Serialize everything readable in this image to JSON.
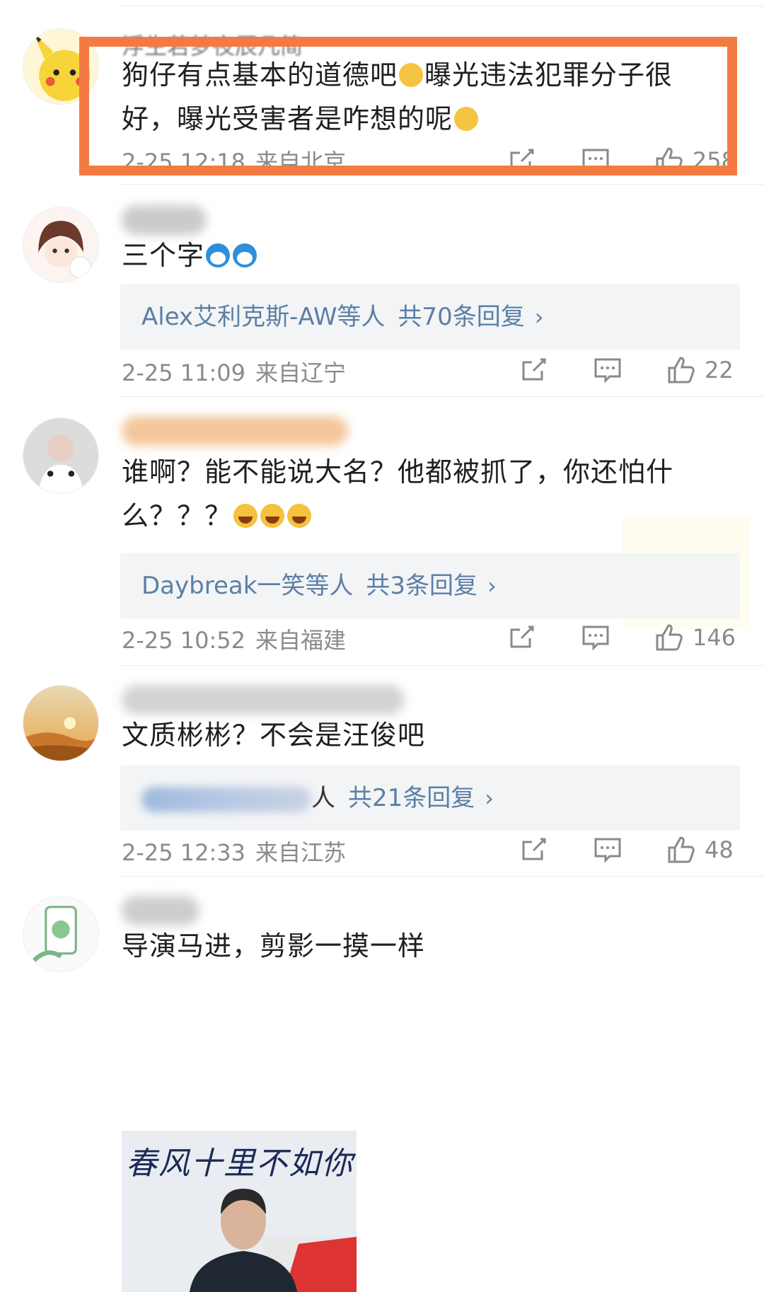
{
  "comments": [
    {
      "username": "浮生若梦夜辰凡简",
      "text_parts": [
        {
          "t": "狗仔有点基本的道德吧"
        },
        {
          "emoji": "face"
        },
        {
          "t": "曝光违法犯罪分子很好，曝光受害者是咋想的呢"
        },
        {
          "emoji": "face"
        }
      ],
      "time": "2-25 12:18",
      "location": "来自北京",
      "likes": "258",
      "colors": {
        "highlight": "#f47a44"
      }
    },
    {
      "text_parts": [
        {
          "t": "三个字"
        },
        {
          "emoji": "dora"
        },
        {
          "emoji": "dora"
        }
      ],
      "reply_names": "Alex艾利克斯-AW等人",
      "reply_count": "共70条回复",
      "time": "2-25 11:09",
      "location": "来自辽宁",
      "likes": "22"
    },
    {
      "text_parts": [
        {
          "t": "谁啊？能不能说大名？他都被抓了，你还怕什么？？？"
        },
        {
          "emoji": "laugh"
        },
        {
          "emoji": "laugh"
        },
        {
          "emoji": "laugh"
        }
      ],
      "reply_names": "Daybreak一笑等人",
      "reply_count": "共3条回复",
      "time": "2-25 10:52",
      "location": "来自福建",
      "likes": "146"
    },
    {
      "text_parts": [
        {
          "t": "文质彬彬？不会是汪俊吧"
        }
      ],
      "reply_names_suffix": "人",
      "reply_count": "共21条回复",
      "time": "2-25 12:33",
      "location": "来自江苏",
      "likes": "48"
    },
    {
      "text_parts": [
        {
          "t": "导演马进，剪影一摸一样"
        }
      ],
      "image_caption": "春风十里不如你"
    }
  ],
  "reply_arrow": "›",
  "icons": [
    "share-icon",
    "comment-icon",
    "like-icon"
  ],
  "colors": {
    "reply_link": "#5b7fa6",
    "meta": "#8a8a8a",
    "reply_bg": "#f3f4f6"
  }
}
